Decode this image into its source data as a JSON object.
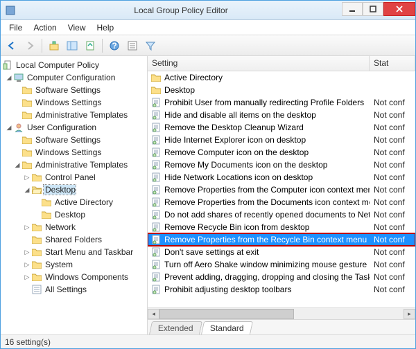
{
  "window": {
    "title": "Local Group Policy Editor"
  },
  "menubar": [
    "File",
    "Action",
    "View",
    "Help"
  ],
  "columns": {
    "setting": "Setting",
    "state": "Stat"
  },
  "tree": {
    "root": "Local Computer Policy",
    "cc": "Computer Configuration",
    "cc_sw": "Software Settings",
    "cc_win": "Windows Settings",
    "cc_at": "Administrative Templates",
    "uc": "User Configuration",
    "uc_sw": "Software Settings",
    "uc_win": "Windows Settings",
    "uc_at": "Administrative Templates",
    "cp": "Control Panel",
    "dt": "Desktop",
    "dt_ad": "Active Directory",
    "dt_dt": "Desktop",
    "net": "Network",
    "sf": "Shared Folders",
    "sm": "Start Menu and Taskbar",
    "sys": "System",
    "wc": "Windows Components",
    "all": "All Settings"
  },
  "settings": [
    {
      "type": "folder",
      "name": "Active Directory",
      "state": ""
    },
    {
      "type": "folder",
      "name": "Desktop",
      "state": ""
    },
    {
      "type": "policy",
      "name": "Prohibit User from manually redirecting Profile Folders",
      "state": "Not conf"
    },
    {
      "type": "policy",
      "name": "Hide and disable all items on the desktop",
      "state": "Not conf"
    },
    {
      "type": "policy",
      "name": "Remove the Desktop Cleanup Wizard",
      "state": "Not conf"
    },
    {
      "type": "policy",
      "name": "Hide Internet Explorer icon on desktop",
      "state": "Not conf"
    },
    {
      "type": "policy",
      "name": "Remove Computer icon on the desktop",
      "state": "Not conf"
    },
    {
      "type": "policy",
      "name": "Remove My Documents icon on the desktop",
      "state": "Not conf"
    },
    {
      "type": "policy",
      "name": "Hide Network Locations icon on desktop",
      "state": "Not conf"
    },
    {
      "type": "policy",
      "name": "Remove Properties from the Computer icon context menu",
      "state": "Not conf"
    },
    {
      "type": "policy",
      "name": "Remove Properties from the Documents icon context menu",
      "state": "Not conf"
    },
    {
      "type": "policy",
      "name": "Do not add shares of recently opened documents to Networ…",
      "state": "Not conf"
    },
    {
      "type": "policy",
      "name": "Remove Recycle Bin icon from desktop",
      "state": "Not conf"
    },
    {
      "type": "policy",
      "name": "Remove Properties from the Recycle Bin context menu",
      "state": "Not conf",
      "selected": true
    },
    {
      "type": "policy",
      "name": "Don't save settings at exit",
      "state": "Not conf"
    },
    {
      "type": "policy",
      "name": "Turn off Aero Shake window minimizing mouse gesture",
      "state": "Not conf"
    },
    {
      "type": "policy",
      "name": "Prevent adding, dragging, dropping and closing the Taskbar…",
      "state": "Not conf"
    },
    {
      "type": "policy",
      "name": "Prohibit adjusting desktop toolbars",
      "state": "Not conf"
    }
  ],
  "tabs": {
    "extended": "Extended",
    "standard": "Standard"
  },
  "status": "16 setting(s)"
}
